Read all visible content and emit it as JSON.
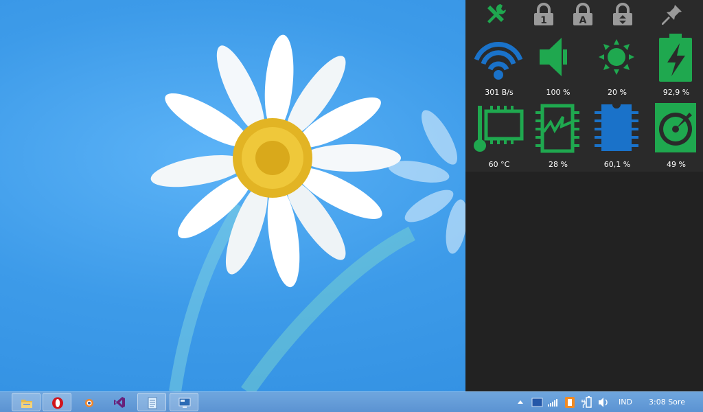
{
  "panel": {
    "top_icons": [
      {
        "icon": "tools-icon",
        "color": "#1fa84f"
      },
      {
        "icon": "caps-lock-icon",
        "label": "1",
        "color": "#9a9a9a"
      },
      {
        "icon": "num-lock-icon",
        "label": "A",
        "color": "#9a9a9a"
      },
      {
        "icon": "scroll-lock-icon",
        "color": "#9a9a9a"
      },
      {
        "icon": "pin-icon",
        "color": "#9a9a9a"
      }
    ],
    "tiles": [
      {
        "icon": "wifi-icon",
        "value": "301 B/s",
        "color": "#1a72c9"
      },
      {
        "icon": "volume-icon",
        "value": "100 %",
        "color": "#1fa84f"
      },
      {
        "icon": "brightness-icon",
        "value": "20 %",
        "color": "#1fa84f"
      },
      {
        "icon": "battery-icon",
        "value": "92,9 %",
        "color": "#1fa84f"
      },
      {
        "icon": "cpu-temperature-icon",
        "value": "60 °C",
        "color": "#1fa84f"
      },
      {
        "icon": "cpu-load-icon",
        "value": "28 %",
        "color": "#1fa84f"
      },
      {
        "icon": "memory-icon",
        "value": "60,1 %",
        "color": "#1a72c9"
      },
      {
        "icon": "disk-icon",
        "value": "49 %",
        "color": "#1fa84f"
      }
    ]
  },
  "taskbar": {
    "apps": [
      {
        "icon": "file-explorer-icon",
        "framed": true
      },
      {
        "icon": "opera-icon",
        "framed": true
      },
      {
        "icon": "blender-icon",
        "framed": false
      },
      {
        "icon": "visual-studio-icon",
        "framed": false
      },
      {
        "icon": "notepad-icon",
        "framed": true
      },
      {
        "icon": "remote-desktop-icon",
        "framed": true
      }
    ],
    "tray": {
      "language": "IND",
      "clock": "3:08 Sore"
    }
  },
  "colors": {
    "green": "#1fa84f",
    "blue": "#1a72c9",
    "panel_bg": "#222222",
    "taskbar": "#5b93d2"
  }
}
